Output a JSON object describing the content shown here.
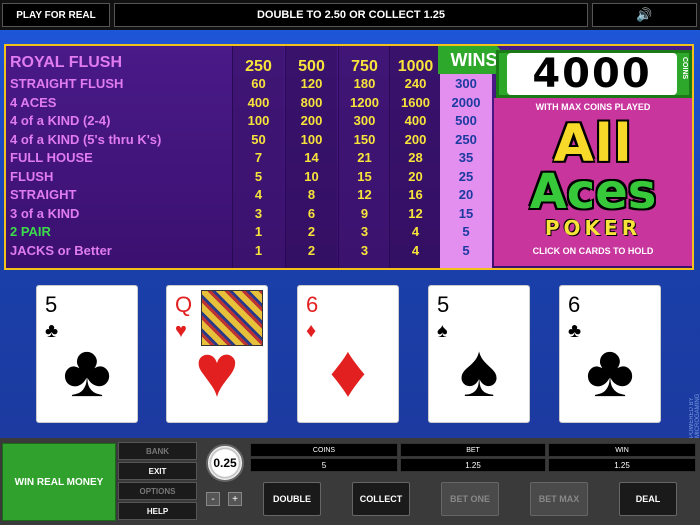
{
  "topbar": {
    "play_for_real": "PLAY FOR REAL",
    "message": "DOUBLE TO 2.50 OR COLLECT 1.25",
    "sound_icon": "speaker-icon"
  },
  "paytable": {
    "hands": [
      "ROYAL FLUSH",
      "STRAIGHT FLUSH",
      "4 ACES",
      "4 of a KIND (2-4)",
      "4 of a KIND (5's thru K's)",
      "FULL HOUSE",
      "FLUSH",
      "STRAIGHT",
      "3 of a KIND",
      "2 PAIR",
      "JACKS or Better"
    ],
    "columns": [
      [
        "250",
        "60",
        "400",
        "100",
        "50",
        "7",
        "5",
        "4",
        "3",
        "1",
        "1"
      ],
      [
        "500",
        "120",
        "800",
        "200",
        "100",
        "14",
        "10",
        "8",
        "6",
        "2",
        "2"
      ],
      [
        "750",
        "180",
        "1200",
        "300",
        "150",
        "21",
        "15",
        "12",
        "9",
        "3",
        "3"
      ],
      [
        "1000",
        "240",
        "1600",
        "400",
        "200",
        "28",
        "20",
        "16",
        "12",
        "4",
        "4"
      ],
      [
        "4000",
        "300",
        "2000",
        "500",
        "250",
        "35",
        "25",
        "20",
        "15",
        "5",
        "5"
      ]
    ]
  },
  "wins": {
    "label": "WINS",
    "value": "4000",
    "coins_label": "COINS",
    "max_note": "WITH MAX COINS PLAYED"
  },
  "logo": {
    "line1": "All",
    "line2": "Aces",
    "line3": "POKER",
    "click_note": "CLICK ON CARDS TO HOLD"
  },
  "cards": [
    {
      "rank": "5",
      "suit": "♣",
      "color": "#000000"
    },
    {
      "rank": "Q",
      "suit": "♥",
      "color": "#e32020"
    },
    {
      "rank": "6",
      "suit": "♦",
      "color": "#e32020"
    },
    {
      "rank": "5",
      "suit": "♠",
      "color": "#000000"
    },
    {
      "rank": "6",
      "suit": "♣",
      "color": "#000000"
    }
  ],
  "powered": "POWERED BY MICROGAMING",
  "bottom": {
    "win_real": "WIN REAL MONEY",
    "bank": "BANK",
    "exit": "EXIT",
    "options": "OPTIONS",
    "help": "HELP",
    "chip_value": "0.25",
    "minus": "-",
    "plus": "+",
    "coins_label": "COINS",
    "coins_value": "5",
    "bet_label": "BET",
    "bet_value": "1.25",
    "win_label": "WIN",
    "win_value": "1.25",
    "double": "DOUBLE",
    "collect": "COLLECT",
    "bet_one": "BET ONE",
    "bet_max": "BET MAX",
    "deal": "DEAL"
  },
  "colors": {
    "accent_gold": "#f2c21b",
    "paytable_purple": "#4a1a88",
    "win_green": "#2ea82a",
    "table_blue": "#1d56d6"
  }
}
